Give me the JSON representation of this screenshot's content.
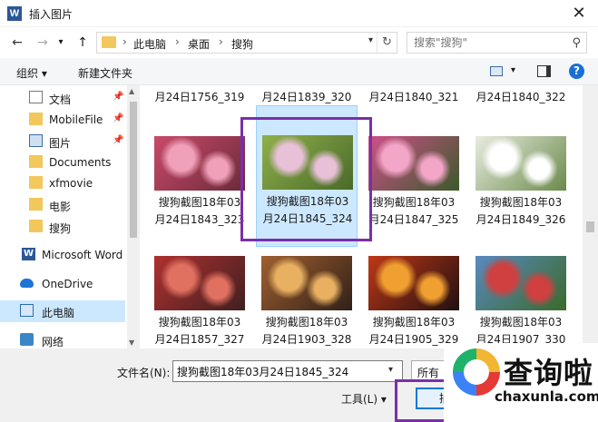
{
  "window": {
    "app_icon": "W",
    "title": "插入图片",
    "close": "✕"
  },
  "nav": {
    "back": "←",
    "forward": "→",
    "dropdown": "▾",
    "up": "↑"
  },
  "address": {
    "crumbs": [
      "此电脑",
      "桌面",
      "搜狗"
    ],
    "separator": "›",
    "refresh": "↻",
    "dropdown": "▾"
  },
  "search": {
    "placeholder": "搜索\"搜狗\"",
    "icon": "⚲"
  },
  "toolbar": {
    "organize": "组织 ▾",
    "new_folder": "新建文件夹",
    "view_dropdown": "▾",
    "help": "?"
  },
  "sidebar": {
    "items": [
      {
        "label": "文档",
        "icon": "document-icon",
        "pinned": true
      },
      {
        "label": "MobileFile",
        "icon": "folder-icon",
        "pinned": true
      },
      {
        "label": "图片",
        "icon": "pictures-icon",
        "pinned": true
      },
      {
        "label": "Documents",
        "icon": "folder-icon",
        "pinned": false
      },
      {
        "label": "xfmovie",
        "icon": "folder-icon",
        "pinned": false
      },
      {
        "label": "电影",
        "icon": "folder-icon",
        "pinned": false
      },
      {
        "label": "搜狗",
        "icon": "folder-icon",
        "pinned": false
      },
      {
        "label": "Microsoft Word",
        "icon": "word-icon",
        "pinned": false
      },
      {
        "label": "OneDrive",
        "icon": "cloud-icon",
        "pinned": false
      },
      {
        "label": "此电脑",
        "icon": "computer-icon",
        "pinned": false,
        "selected": true
      },
      {
        "label": "网络",
        "icon": "network-icon",
        "pinned": false
      }
    ],
    "pin_glyph": "📌"
  },
  "files": {
    "top_row": [
      "月24日1756_319",
      "月24日1839_320",
      "月24日1840_321",
      "月24日1840_322"
    ],
    "tiles": [
      {
        "line1": "搜狗截图18年03",
        "line2": "月24日1843_323",
        "colors": [
          "#c94a6a",
          "#f0a0b8",
          "#6b2a3a"
        ]
      },
      {
        "line1": "搜狗截图18年03",
        "line2": "月24日1845_324",
        "colors": [
          "#8fb04a",
          "#e8c0d8",
          "#4a6a2a"
        ],
        "selected": true
      },
      {
        "line1": "搜狗截图18年03",
        "line2": "月24日1847_325",
        "colors": [
          "#d0508a",
          "#f4a6c8",
          "#3a5a2a"
        ]
      },
      {
        "line1": "搜狗截图18年03",
        "line2": "月24日1849_326",
        "colors": [
          "#e8ece0",
          "#ffffff",
          "#6a8a4a"
        ]
      },
      {
        "line1": "搜狗截图18年03",
        "line2": "月24日1857_327",
        "colors": [
          "#b03030",
          "#e07060",
          "#402020"
        ]
      },
      {
        "line1": "搜狗截图18年03",
        "line2": "月24日1903_328",
        "colors": [
          "#a06030",
          "#e8b060",
          "#302018"
        ]
      },
      {
        "line1": "搜狗截图18年03",
        "line2": "月24日1905_329",
        "colors": [
          "#c03818",
          "#f0a030",
          "#201010"
        ]
      },
      {
        "line1": "搜狗截图18年03",
        "line2": "月24日1907_330",
        "colors": [
          "#5a8ac0",
          "#d04040",
          "#3a6a2a"
        ]
      }
    ]
  },
  "footer": {
    "filename_label": "文件名(N):",
    "filename_value": "搜狗截图18年03月24日1845_324",
    "filetype": "所有",
    "tools": "工具(L) ▾",
    "insert": "插入"
  },
  "watermark": {
    "cn": "查询啦",
    "en": "chaxunla.com"
  },
  "colors": {
    "highlight": "#7a2fa8",
    "selection": "#cce8ff",
    "accent": "#0078d7"
  }
}
